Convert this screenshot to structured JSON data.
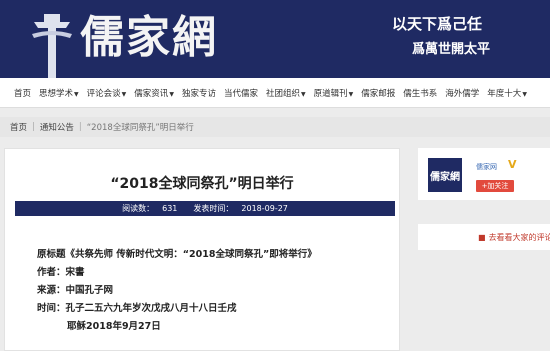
{
  "banner": {
    "logo": "儒家網",
    "motto_line1": "以天下爲己任",
    "motto_line2": "爲萬世開太平"
  },
  "nav": {
    "items": [
      {
        "label": "首页",
        "dropdown": false
      },
      {
        "label": "思想学术",
        "dropdown": true
      },
      {
        "label": "评论会谈",
        "dropdown": true
      },
      {
        "label": "儒家资讯",
        "dropdown": true
      },
      {
        "label": "独家专访",
        "dropdown": false
      },
      {
        "label": "当代儒家",
        "dropdown": false
      },
      {
        "label": "社团组织",
        "dropdown": true
      },
      {
        "label": "原道辑刊",
        "dropdown": true
      },
      {
        "label": "儒家邮报",
        "dropdown": false
      },
      {
        "label": "儒生书系",
        "dropdown": false
      },
      {
        "label": "海外儒学",
        "dropdown": false
      },
      {
        "label": "年度十大",
        "dropdown": true
      }
    ]
  },
  "breadcrumb": {
    "home": "首页",
    "section": "通知公告",
    "current": "“2018全球同祭孔”明日举行"
  },
  "article": {
    "title": "“2018全球同祭孔”明日举行",
    "views_label": "阅读数：",
    "views": "631",
    "date_label": "发表时间：",
    "date": "2018-09-27",
    "lines": [
      "原标题《共祭先师 传新时代文明：“2018全球同祭孔”即将举行》",
      "作者：宋書",
      "来源：中国孔子网",
      "时间：孔子二五六九年岁次戊戌八月十八日壬戌",
      "耶稣2018年9月27日"
    ]
  },
  "sidebar": {
    "avatar_text": "儒家網",
    "name": "儒家网",
    "verified": "V",
    "follow_label": "+加关注",
    "discuss_link": "去看看大家的评论"
  }
}
